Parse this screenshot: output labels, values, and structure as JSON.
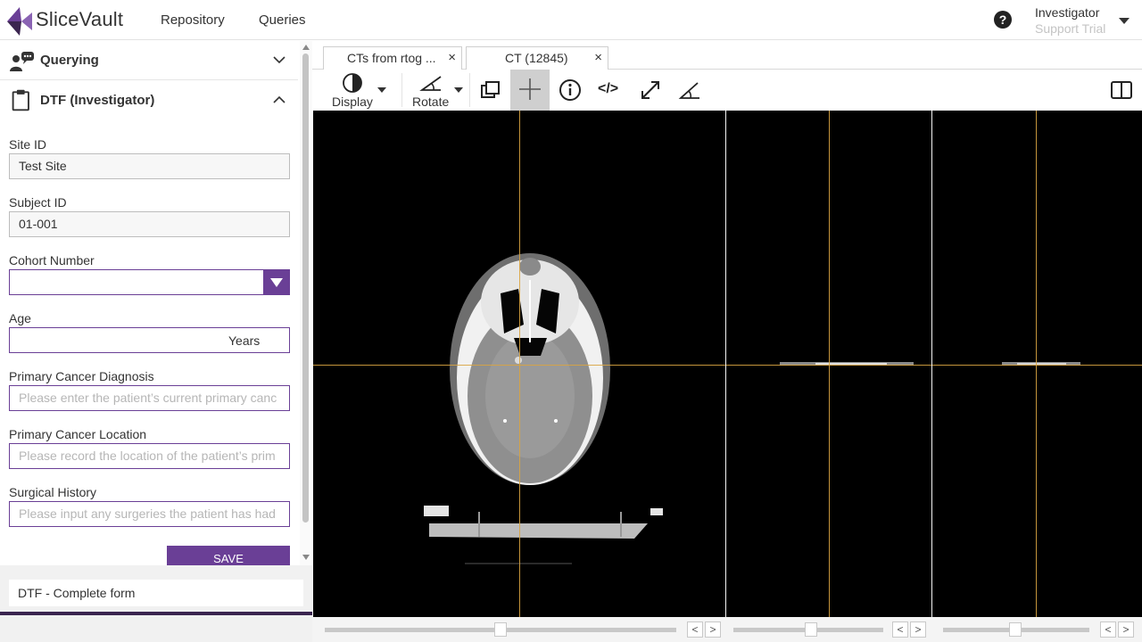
{
  "app": {
    "brand": "SliceVault",
    "nav": [
      "Repository",
      "Queries"
    ],
    "user": {
      "name": "Investigator",
      "role": "Support Trial"
    },
    "accent": "#6a3f96"
  },
  "sidebar": {
    "querying": {
      "title": "Querying",
      "icon": "users-chat-icon"
    },
    "dtf": {
      "title": "DTF (Investigator)",
      "icon": "clipboard-icon"
    },
    "fields": {
      "site_id": {
        "label": "Site ID",
        "value": "Test Site"
      },
      "subject_id": {
        "label": "Subject ID",
        "value": "01-001"
      },
      "cohort": {
        "label": "Cohort Number",
        "value": ""
      },
      "age": {
        "label": "Age",
        "value": "",
        "suffix": "Years"
      },
      "diagnosis": {
        "label": "Primary Cancer Diagnosis",
        "placeholder": "Please enter the patient’s current primary canc"
      },
      "location": {
        "label": "Primary Cancer Location",
        "placeholder": "Please record the location of the patient’s prim"
      },
      "surgical": {
        "label": "Surgical History",
        "placeholder": "Please input any surgeries the patient has had"
      }
    },
    "save_label": "SAVE",
    "complete_form": "DTF - Complete form"
  },
  "viewer": {
    "tabs": [
      {
        "label": "CTs from rtog ...",
        "close": "×"
      },
      {
        "label": "CT (12845)",
        "close": "×"
      }
    ],
    "toolbar": {
      "display_label": "Display",
      "rotate_label": "Rotate",
      "code_symbol": "</>"
    },
    "step_prev": "<",
    "step_next": ">",
    "slices": [
      {
        "position": 0.5
      },
      {
        "position": 0.55
      },
      {
        "position": 0.5
      }
    ]
  }
}
